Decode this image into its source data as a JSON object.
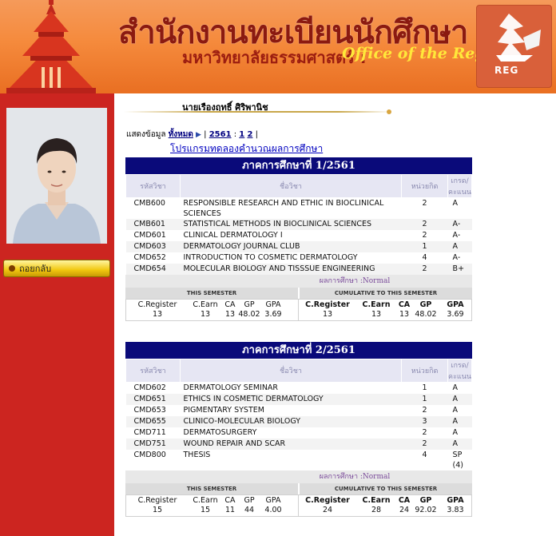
{
  "header": {
    "title_th": "สำนักงานทะเบียนนักศึกษา",
    "subtitle_th": "มหาวิทยาลัยธรรมศาสตร์ :",
    "subtitle_en": "Office of the Registrar",
    "logo_text": "REG"
  },
  "sidebar": {
    "back_label": "ถอยกลับ"
  },
  "student": {
    "name": "นายเรืองฤทธิ์ ศิริพานิช"
  },
  "filter": {
    "label": "แสดงข้อมูล",
    "all_label": "ทั้งหมด",
    "sep1": "|",
    "year": "2561",
    "colon": ":",
    "sem1": "1",
    "sem2": "2",
    "sep2": "|",
    "calc_link": "โปรแกรมทดลองคำนวณผลการศึกษา"
  },
  "table_headers": {
    "code": "รหัสวิชา",
    "name": "ชื่อวิชา",
    "credit": "หน่วยกิต",
    "grade": "เกรด/คะแนน"
  },
  "summary_labels": {
    "status": "ผลการศึกษา :Normal",
    "this_semester": "THIS SEMESTER",
    "cumulative": "CUMULATIVE TO THIS SEMESTER",
    "c_register": "C.Register",
    "c_earn": "C.Earn",
    "ca": "CA",
    "gp": "GP",
    "gpa": "GPA"
  },
  "semesters": [
    {
      "title": "ภาคการศึกษาที่ 1/2561",
      "courses": [
        {
          "code": "CMB600",
          "name": "RESPONSIBLE RESEARCH AND ETHIC IN BIOCLINICAL SCIENCES",
          "credit": "2",
          "grade": "A"
        },
        {
          "code": "CMB601",
          "name": "STATISTICAL METHODS IN BIOCLINICAL SCIENCES",
          "credit": "2",
          "grade": "A-"
        },
        {
          "code": "CMD601",
          "name": "CLINICAL DERMATOLOGY I",
          "credit": "2",
          "grade": "A-"
        },
        {
          "code": "CMD603",
          "name": "DERMATOLOGY JOURNAL CLUB",
          "credit": "1",
          "grade": "A"
        },
        {
          "code": "CMD652",
          "name": "INTRODUCTION TO COSMETIC DERMATOLOGY",
          "credit": "4",
          "grade": "A-"
        },
        {
          "code": "CMD654",
          "name": "MOLECULAR BIOLOGY AND TISSSUE ENGINEERING",
          "credit": "2",
          "grade": "B+"
        }
      ],
      "this": {
        "c_register": "13",
        "c_earn": "13",
        "ca": "13",
        "gp": "48.02",
        "gpa": "3.69"
      },
      "cum": {
        "c_register": "13",
        "c_earn": "13",
        "ca": "13",
        "gp": "48.02",
        "gpa": "3.69"
      }
    },
    {
      "title": "ภาคการศึกษาที่ 2/2561",
      "courses": [
        {
          "code": "CMD602",
          "name": "DERMATOLOGY SEMINAR",
          "credit": "1",
          "grade": "A"
        },
        {
          "code": "CMD651",
          "name": "ETHICS IN COSMETIC DERMATOLOGY",
          "credit": "1",
          "grade": "A"
        },
        {
          "code": "CMD653",
          "name": "PIGMENTARY SYSTEM",
          "credit": "2",
          "grade": "A"
        },
        {
          "code": "CMD655",
          "name": "CLINICO-MOLECULAR BIOLOGY",
          "credit": "3",
          "grade": "A"
        },
        {
          "code": "CMD711",
          "name": "DERMATOSURGERY",
          "credit": "2",
          "grade": "A"
        },
        {
          "code": "CMD751",
          "name": "WOUND REPAIR AND SCAR",
          "credit": "2",
          "grade": "A"
        },
        {
          "code": "CMD800",
          "name": "THESIS",
          "credit": "4",
          "grade": "SP (4)"
        }
      ],
      "this": {
        "c_register": "15",
        "c_earn": "15",
        "ca": "11",
        "gp": "44",
        "gpa": "4.00"
      },
      "cum": {
        "c_register": "24",
        "c_earn": "28",
        "ca": "24",
        "gp": "92.02",
        "gpa": "3.83"
      }
    }
  ]
}
